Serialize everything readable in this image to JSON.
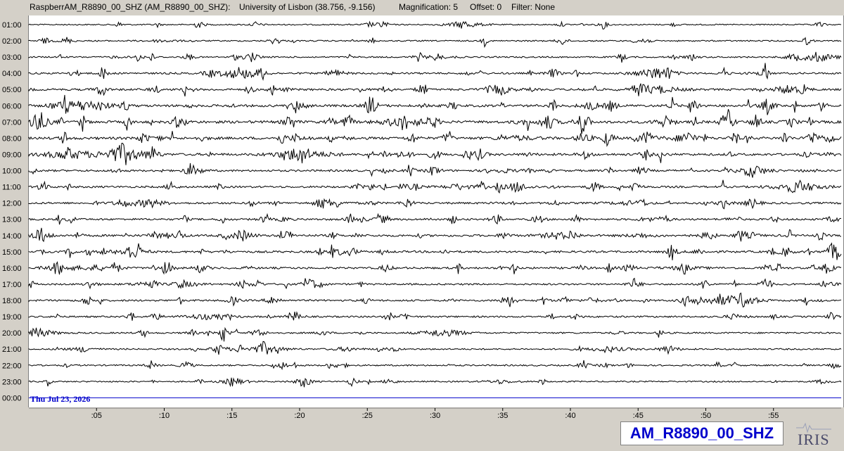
{
  "header": {
    "station_info": "RaspberrAM_R8890_00_SHZ (AM_R8890_00_SHZ):",
    "location": "University of Lisbon (38.756, -9.156)",
    "magnification": "Magnification: 5",
    "offset": "Offset: 0",
    "filter": "Filter: None"
  },
  "chart_data": {
    "type": "helicorder",
    "rows": [
      "01:00",
      "02:00",
      "03:00",
      "04:00",
      "05:00",
      "06:00",
      "07:00",
      "08:00",
      "09:00",
      "10:00",
      "11:00",
      "12:00",
      "13:00",
      "14:00",
      "15:00",
      "16:00",
      "17:00",
      "18:00",
      "19:00",
      "20:00",
      "21:00",
      "22:00",
      "23:00",
      "00:00"
    ],
    "x_ticks": [
      ":05",
      ":10",
      ":15",
      ":20",
      ":25",
      ":30",
      ":35",
      ":40",
      ":45",
      ":50",
      ":55"
    ],
    "x_range_minutes": [
      0,
      60
    ],
    "date_label": "Thu Jul 23, 2026",
    "trace_color": "#000000",
    "current_row_color": "#0000cc",
    "activity": [
      0.15,
      0.2,
      0.25,
      0.4,
      0.5,
      0.65,
      0.75,
      0.7,
      0.6,
      0.45,
      0.45,
      0.45,
      0.45,
      0.55,
      0.5,
      0.45,
      0.35,
      0.4,
      0.35,
      0.3,
      0.25,
      0.25,
      0.2,
      0.0
    ]
  },
  "footer": {
    "station_name": "AM_R8890_00_SHZ",
    "logo_text": "IRIS"
  }
}
